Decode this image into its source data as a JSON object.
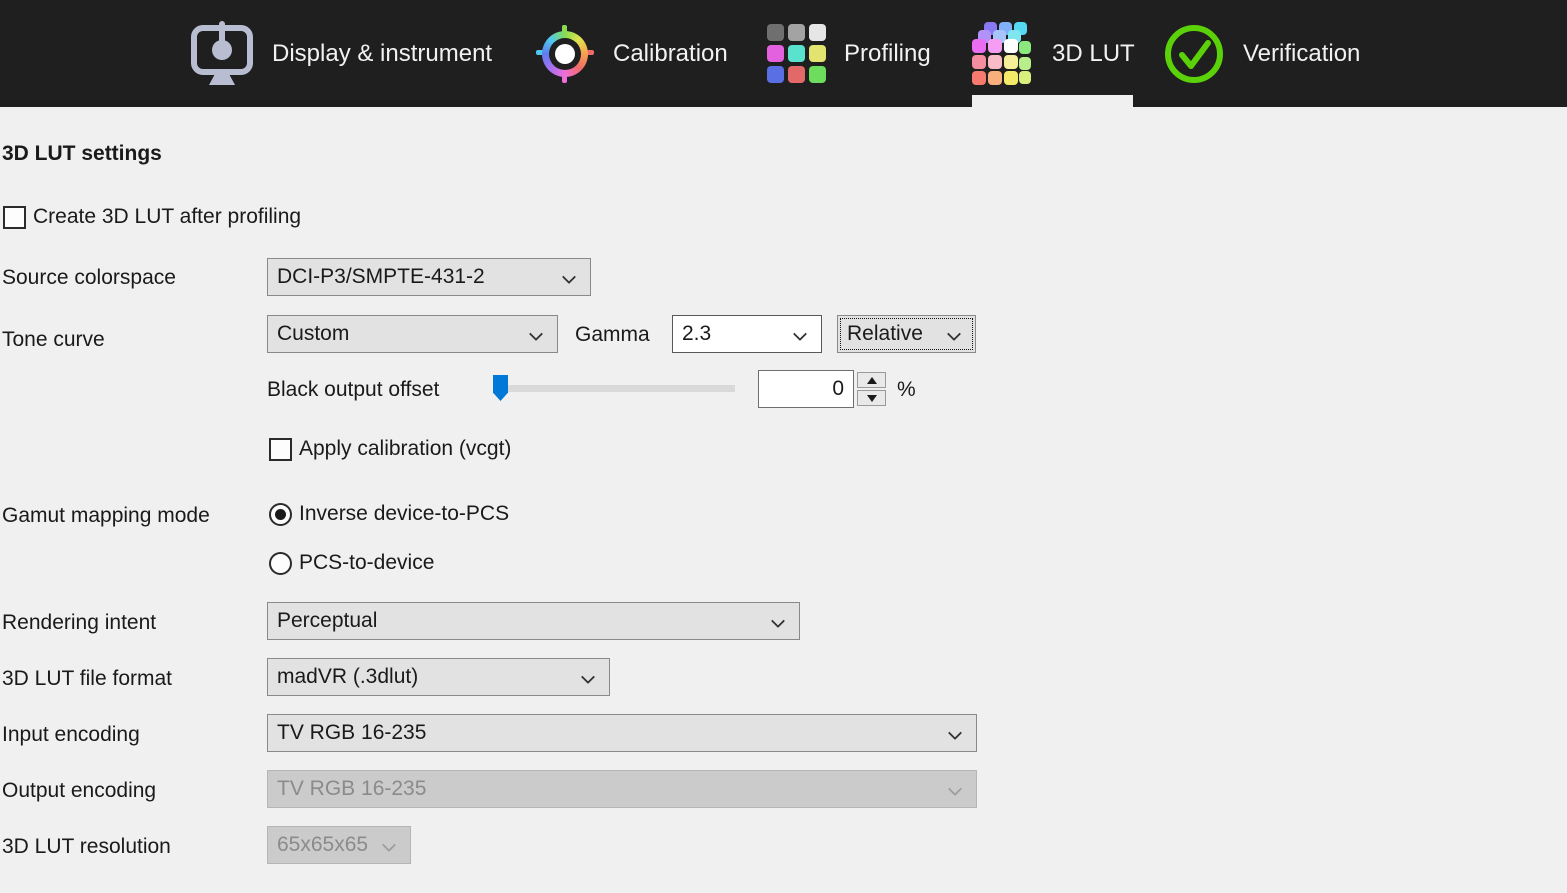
{
  "nav": {
    "tabs": [
      {
        "label": "Display & instrument",
        "icon": "display-instrument-icon",
        "active": false
      },
      {
        "label": "Calibration",
        "icon": "calibration-icon",
        "active": false
      },
      {
        "label": "Profiling",
        "icon": "profiling-icon",
        "active": false
      },
      {
        "label": "3D LUT",
        "icon": "lut-cube-icon",
        "active": true
      },
      {
        "label": "Verification",
        "icon": "verification-icon",
        "active": false
      }
    ]
  },
  "page": {
    "title": "3D LUT settings"
  },
  "settings": {
    "create_lut_checkbox": {
      "label": "Create 3D LUT after profiling",
      "checked": false
    },
    "source_colorspace": {
      "label": "Source colorspace",
      "value": "DCI-P3/SMPTE-431-2"
    },
    "tone_curve": {
      "label": "Tone curve",
      "value": "Custom",
      "gamma_label": "Gamma",
      "gamma_value": "2.3",
      "gamma_mode": "Relative"
    },
    "black_output_offset": {
      "label": "Black output offset",
      "value": "0",
      "unit": "%",
      "slider_percent": 0
    },
    "apply_calibration": {
      "label": "Apply calibration (vcgt)",
      "checked": false
    },
    "gamut_mapping": {
      "label": "Gamut mapping mode",
      "options": [
        {
          "label": "Inverse device-to-PCS",
          "selected": true
        },
        {
          "label": "PCS-to-device",
          "selected": false
        }
      ]
    },
    "rendering_intent": {
      "label": "Rendering intent",
      "value": "Perceptual"
    },
    "file_format": {
      "label": "3D LUT file format",
      "value": "madVR (.3dlut)"
    },
    "input_encoding": {
      "label": "Input encoding",
      "value": "TV RGB 16-235",
      "enabled": true
    },
    "output_encoding": {
      "label": "Output encoding",
      "value": "TV RGB 16-235",
      "enabled": false
    },
    "lut_resolution": {
      "label": "3D LUT resolution",
      "value": "65x65x65",
      "enabled": false
    }
  },
  "colors": {
    "nav_bg": "#1f1f1f",
    "content_bg": "#f0f0f0",
    "accent_blue": "#0078d7",
    "verification_green": "#5ad108",
    "control_bg": "#e2e2e2",
    "control_border": "#898989",
    "disabled_bg": "#cbcbcb",
    "disabled_text": "#8b8b8b"
  }
}
